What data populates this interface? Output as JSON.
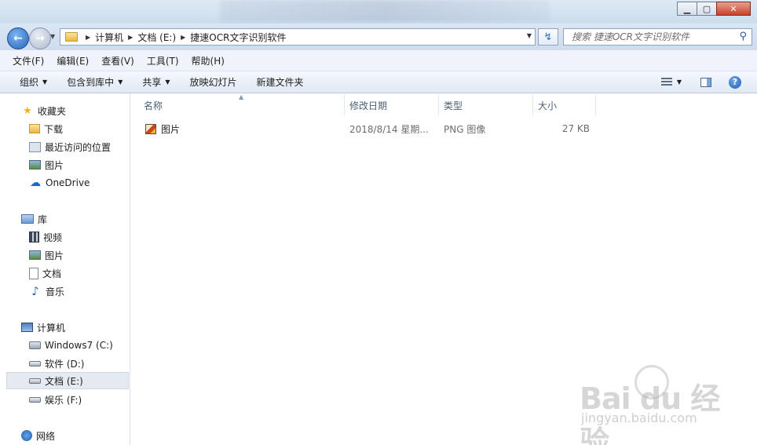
{
  "address": {
    "crumbs": [
      "计算机",
      "文档 (E:)",
      "捷速OCR文字识别软件"
    ]
  },
  "search": {
    "placeholder": "搜索 捷速OCR文字识别软件"
  },
  "menubar": [
    "文件(F)",
    "编辑(E)",
    "查看(V)",
    "工具(T)",
    "帮助(H)"
  ],
  "toolbar": {
    "organize": "组织",
    "include": "包含到库中",
    "share": "共享",
    "slideshow": "放映幻灯片",
    "new_folder": "新建文件夹"
  },
  "nav": {
    "favorites": {
      "label": "收藏夹",
      "items": [
        "下载",
        "最近访问的位置",
        "图片",
        "OneDrive"
      ]
    },
    "libraries": {
      "label": "库",
      "items": [
        "视频",
        "图片",
        "文档",
        "音乐"
      ]
    },
    "computer": {
      "label": "计算机",
      "items": [
        "Windows7 (C:)",
        "软件 (D:)",
        "文档 (E:)",
        "娱乐 (F:)"
      ]
    },
    "network": {
      "label": "网络"
    }
  },
  "columns": {
    "name": "名称",
    "date": "修改日期",
    "type": "类型",
    "size": "大小"
  },
  "files": [
    {
      "name": "图片",
      "date": "2018/8/14 星期...",
      "type": "PNG 图像",
      "size": "27 KB"
    }
  ],
  "watermark": {
    "big": "Bai  du 经验",
    "small": "jingyan.baidu.com"
  }
}
